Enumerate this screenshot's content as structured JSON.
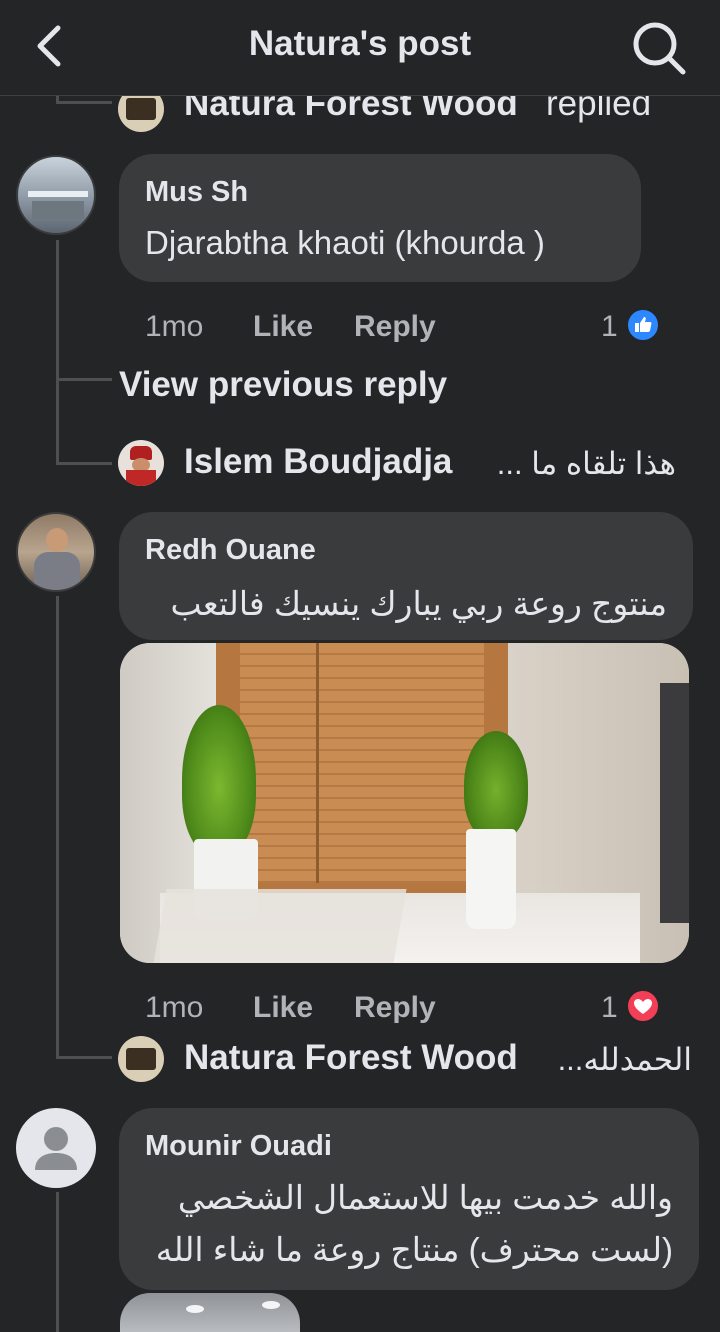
{
  "header": {
    "title": "Natura's post"
  },
  "replied_row": {
    "name": "Natura Forest Wood",
    "suffix": "replied"
  },
  "comments": [
    {
      "author": "Mus Sh",
      "text": "Djarabtha khaoti (khourda )",
      "time": "1mo",
      "like": "Like",
      "reply": "Reply",
      "reactions": "1",
      "reaction_type": "like"
    },
    {
      "author": "Redh Ouane",
      "text": "منتوج روعة ربي يبارك ينسيك فالتعب",
      "time": "1mo",
      "like": "Like",
      "reply": "Reply",
      "reactions": "1",
      "reaction_type": "love"
    },
    {
      "author": "Mounir Ouadi",
      "text_line1": "والله خدمت بيها للاستعمال الشخصي",
      "text_line2": "(لست محترف) منتاج روعة ما شاء الله"
    }
  ],
  "view_previous": "View previous reply",
  "reply_previews": [
    {
      "name": "Islem Boudjadja",
      "snippet": "هذا تلقاه ما ..."
    },
    {
      "name": "Natura Forest Wood",
      "snippet": "الحمدلله..."
    }
  ],
  "colors": {
    "background": "#242526",
    "bubble": "#3a3b3c",
    "like_blue": "#2d88ff",
    "love_red": "#f33e58",
    "muted": "#b0b3b8"
  }
}
